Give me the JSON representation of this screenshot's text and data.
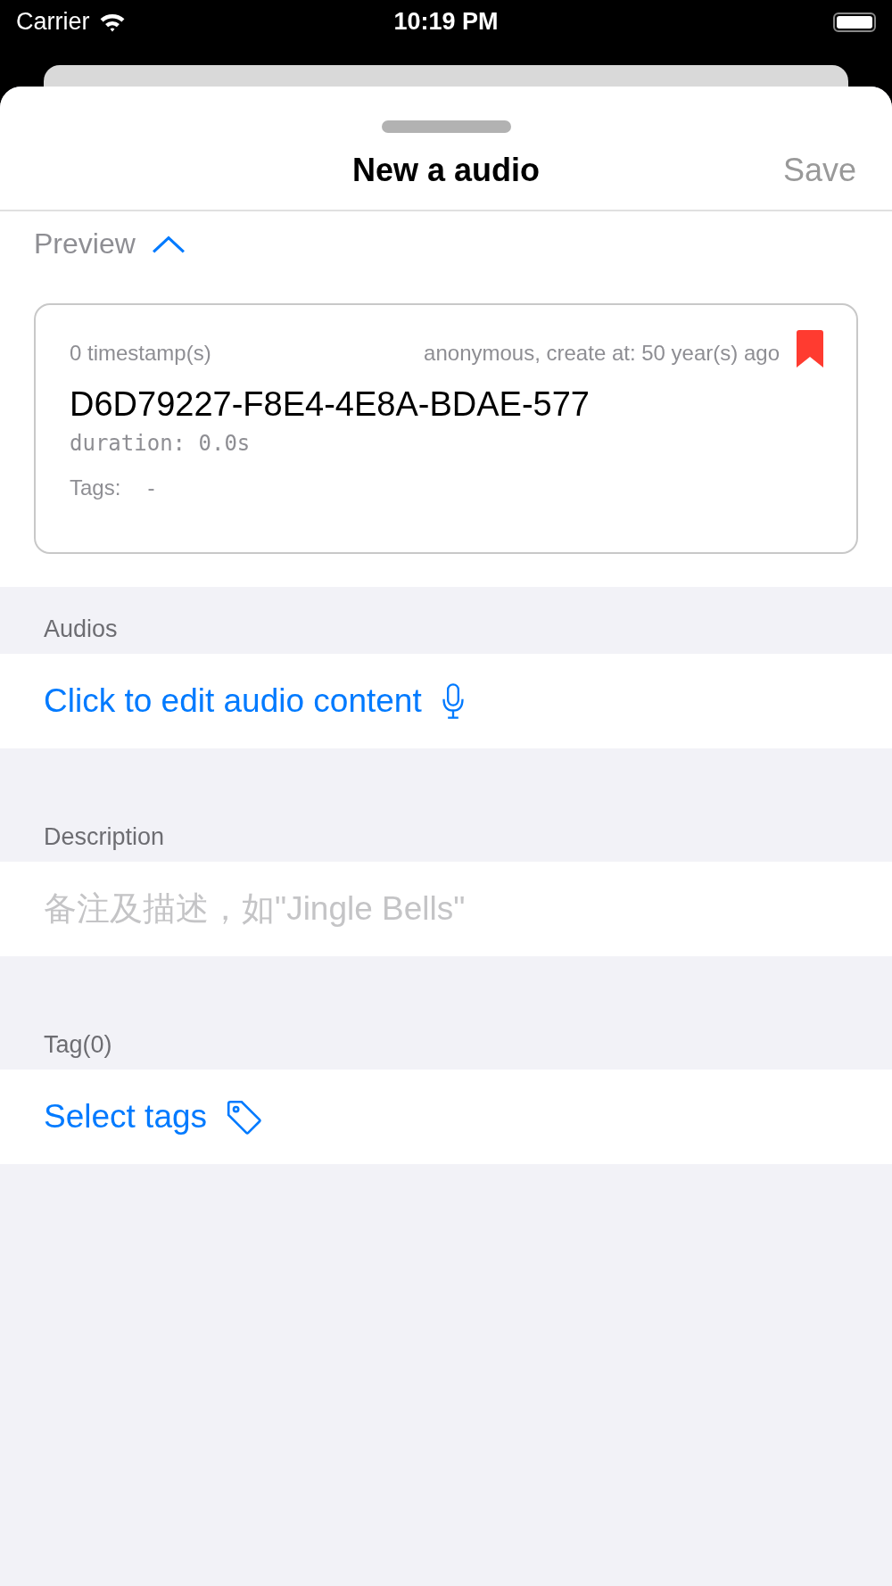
{
  "status_bar": {
    "carrier": "Carrier",
    "time": "10:19 PM"
  },
  "sheet": {
    "title": "New a audio",
    "save_button": {
      "label": "Save",
      "disabled": true
    }
  },
  "preview": {
    "label": "Preview",
    "expanded": true,
    "card": {
      "timestamps": "0 timestamp(s)",
      "meta": "anonymous, create at: 50 year(s) ago",
      "bookmarked": true,
      "name": "D6D79227-F8E4-4E8A-BDAE-577",
      "duration": "duration: 0.0s",
      "tags_label": "Tags:",
      "tags_value": "-"
    }
  },
  "sections": [
    {
      "header": "Audios",
      "kind": "audio_link",
      "text": "Click to edit audio content"
    },
    {
      "header": "Description",
      "kind": "input",
      "placeholder": "备注及描述，如\"Jingle Bells\""
    },
    {
      "header": "Tag(0)",
      "kind": "tag_link",
      "text": "Select tags"
    }
  ]
}
